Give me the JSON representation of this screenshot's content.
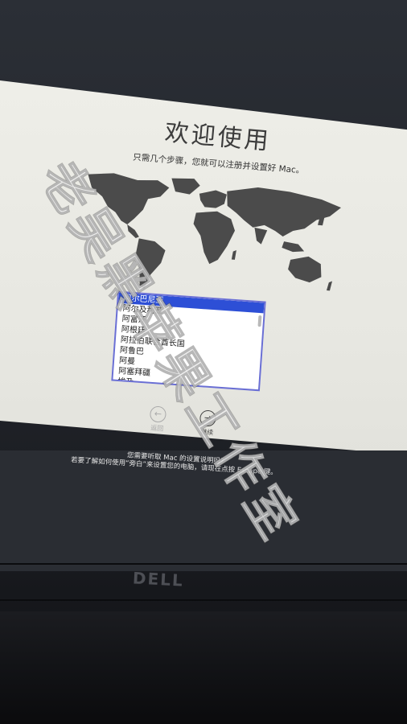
{
  "setup": {
    "title": "欢迎使用",
    "subtitle": "只需几个步骤，您就可以注册并设置好 Mac。",
    "countries": [
      "阿尔巴尼亚",
      "阿尔及利亚",
      "阿富汗",
      "阿根廷",
      "阿拉伯联合酋长国",
      "阿鲁巴",
      "阿曼",
      "阿塞拜疆",
      "埃及"
    ],
    "selected_country_index": 0,
    "back_label": "返回",
    "next_label": "继续",
    "hint_line1": "您需要听取 Mac 的设置说明吗?",
    "hint_line2": "若要了解如何使用“旁白”来设置您的电脑，请现在点按 Escape 键。"
  },
  "hardware": {
    "brand_logo": "DELL"
  },
  "watermark": {
    "text": "老吴黑苹果工作室"
  },
  "colors": {
    "selection": "#2d4fd6",
    "list_border": "#6a6fd4",
    "screen_bg": "#eeeee8",
    "map_land": "#4b4b4b"
  }
}
